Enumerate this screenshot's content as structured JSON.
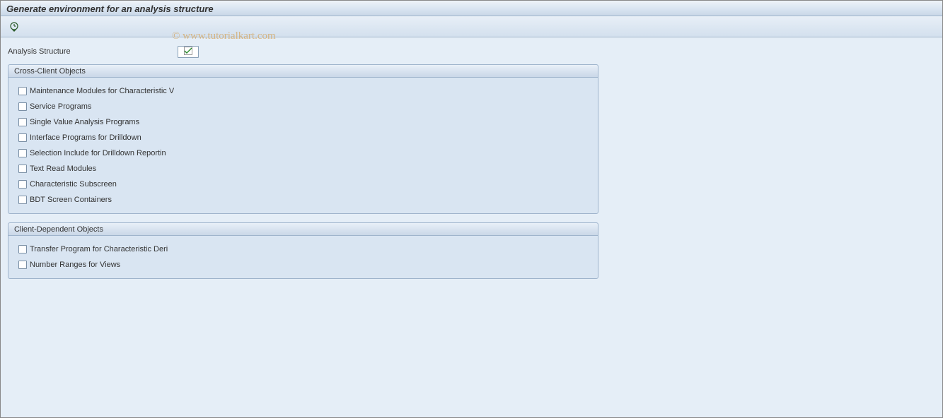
{
  "title": "Generate environment for an analysis structure",
  "toolbar": {
    "execute_icon": "execute"
  },
  "field": {
    "label": "Analysis Structure",
    "value": ""
  },
  "group1": {
    "title": "Cross-Client Objects",
    "items": [
      "Maintenance Modules for Characteristic V",
      "Service Programs",
      "Single Value Analysis Programs",
      "Interface Programs for Drilldown",
      "Selection Include for Drilldown Reportin",
      "Text Read Modules",
      "Characteristic Subscreen",
      "BDT Screen Containers"
    ]
  },
  "group2": {
    "title": "Client-Dependent Objects",
    "items": [
      "Transfer Program for Characteristic Deri",
      "Number Ranges for Views"
    ]
  },
  "watermark": "© www.tutorialkart.com"
}
